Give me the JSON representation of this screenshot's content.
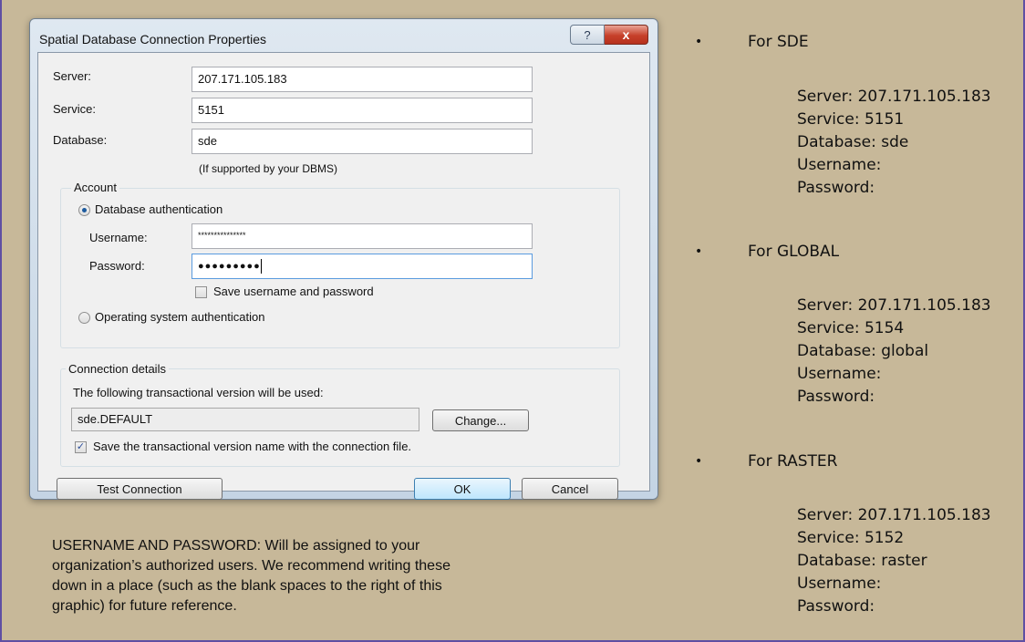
{
  "dialog": {
    "title": "Spatial Database Connection Properties",
    "help_glyph": "?",
    "close_glyph": "x",
    "server_label": "Server:",
    "server_value": "207.171.105.183",
    "service_label": "Service:",
    "service_value": "5151",
    "database_label": "Database:",
    "database_value": "sde",
    "database_hint": "(If supported by your DBMS)",
    "account": {
      "title": "Account",
      "db_auth_label": "Database authentication",
      "username_label": "Username:",
      "username_value": "***************",
      "password_label": "Password:",
      "password_value": "●●●●●●●●●",
      "save_credentials_label": "Save username and password",
      "os_auth_label": "Operating system authentication"
    },
    "connection": {
      "title": "Connection details",
      "version_text": "The following transactional version will be used:",
      "version_value": "sde.DEFAULT",
      "change_label": "Change...",
      "save_version_label": "Save the transactional version name with the connection file."
    },
    "test_connection_label": "Test Connection",
    "ok_label": "OK",
    "cancel_label": "Cancel"
  },
  "right": {
    "bullet_glyph": "•",
    "sections": [
      {
        "heading": "For SDE",
        "lines": [
          "Server:  207.171.105.183",
          "Service:  5151",
          "Database: sde",
          "Username:",
          "Password:"
        ]
      },
      {
        "heading": "For GLOBAL",
        "lines": [
          "Server:  207.171.105.183",
          "Service:  5154",
          "Database: global",
          "Username:",
          "Password:"
        ]
      },
      {
        "heading": "For RASTER",
        "lines": [
          "Server:  207.171.105.183",
          "Service:  5152",
          "Database: raster",
          "Username:",
          "Password:"
        ]
      }
    ]
  },
  "note": {
    "line1": "USERNAME AND PASSWORD:  Will be assigned to your",
    "line2": "organization’s authorized users.  We recommend writing these",
    "line3": "down in a place (such as the blank spaces to the right of this",
    "line4": "graphic) for future reference."
  }
}
